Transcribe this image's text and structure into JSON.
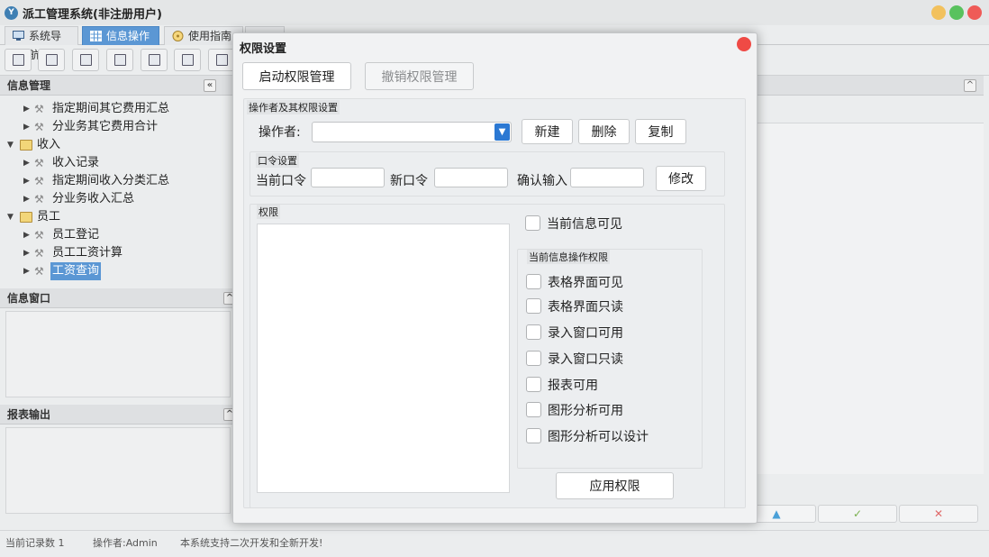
{
  "app": {
    "title": "派工管理系统(非注册用户)",
    "logo_text": "Y",
    "tabs": [
      {
        "label": "系统导航"
      },
      {
        "label": "信息操作"
      },
      {
        "label": "使用指南"
      }
    ],
    "toolbar_icons": [
      "search-icon",
      "list-icon",
      "document-icon",
      "users-icon",
      "window-icon",
      "export-icon",
      "print-icon"
    ]
  },
  "left_panel": {
    "info_manage_title": "信息管理",
    "tree": [
      {
        "label": "指定期间其它费用汇总",
        "level": 2,
        "type": "item"
      },
      {
        "label": "分业务其它费用合计",
        "level": 2,
        "type": "item"
      },
      {
        "label": "收入",
        "level": 1,
        "type": "folder"
      },
      {
        "label": "收入记录",
        "level": 2,
        "type": "item"
      },
      {
        "label": "指定期间收入分类汇总",
        "level": 2,
        "type": "item"
      },
      {
        "label": "分业务收入汇总",
        "level": 2,
        "type": "item"
      },
      {
        "label": "员工",
        "level": 1,
        "type": "folder"
      },
      {
        "label": "员工登记",
        "level": 2,
        "type": "item"
      },
      {
        "label": "员工工资计算",
        "level": 2,
        "type": "item"
      },
      {
        "label": "工资查询",
        "level": 2,
        "type": "item",
        "selected": true
      }
    ],
    "info_window_title": "信息窗口",
    "report_output_title": "报表输出"
  },
  "right_panel": {
    "nav_buttons": [
      "▲",
      "✓",
      "✕"
    ]
  },
  "status": {
    "record_count": "当前记录数 1",
    "operator": "操作者:Admin",
    "message": "本系统支持二次开发和全新开发!"
  },
  "dialog": {
    "title": "权限设置",
    "start_btn": "启动权限管理",
    "revoke_btn": "撤销权限管理",
    "operator_group_title": "操作者及其权限设置",
    "operator_label": "操作者:",
    "operator_value": "",
    "new_btn": "新建",
    "delete_btn": "删除",
    "copy_btn": "复制",
    "password_group_title": "口令设置",
    "current_pw_label": "当前口令",
    "new_pw_label": "新口令",
    "confirm_label": "确认输入",
    "modify_btn": "修改",
    "perm_group_title": "权限",
    "current_visible_label": "当前信息可见",
    "ops_group_title": "当前信息操作权限",
    "ops": [
      "表格界面可见",
      "表格界面只读",
      "录入窗口可用",
      "录入窗口只读",
      "报表可用",
      "图形分析可用",
      "图形分析可以设计"
    ],
    "apply_btn": "应用权限"
  },
  "colors": {
    "accent": "#5b97d4",
    "close": "#ef4a45",
    "dropdown": "#2b78d3"
  }
}
